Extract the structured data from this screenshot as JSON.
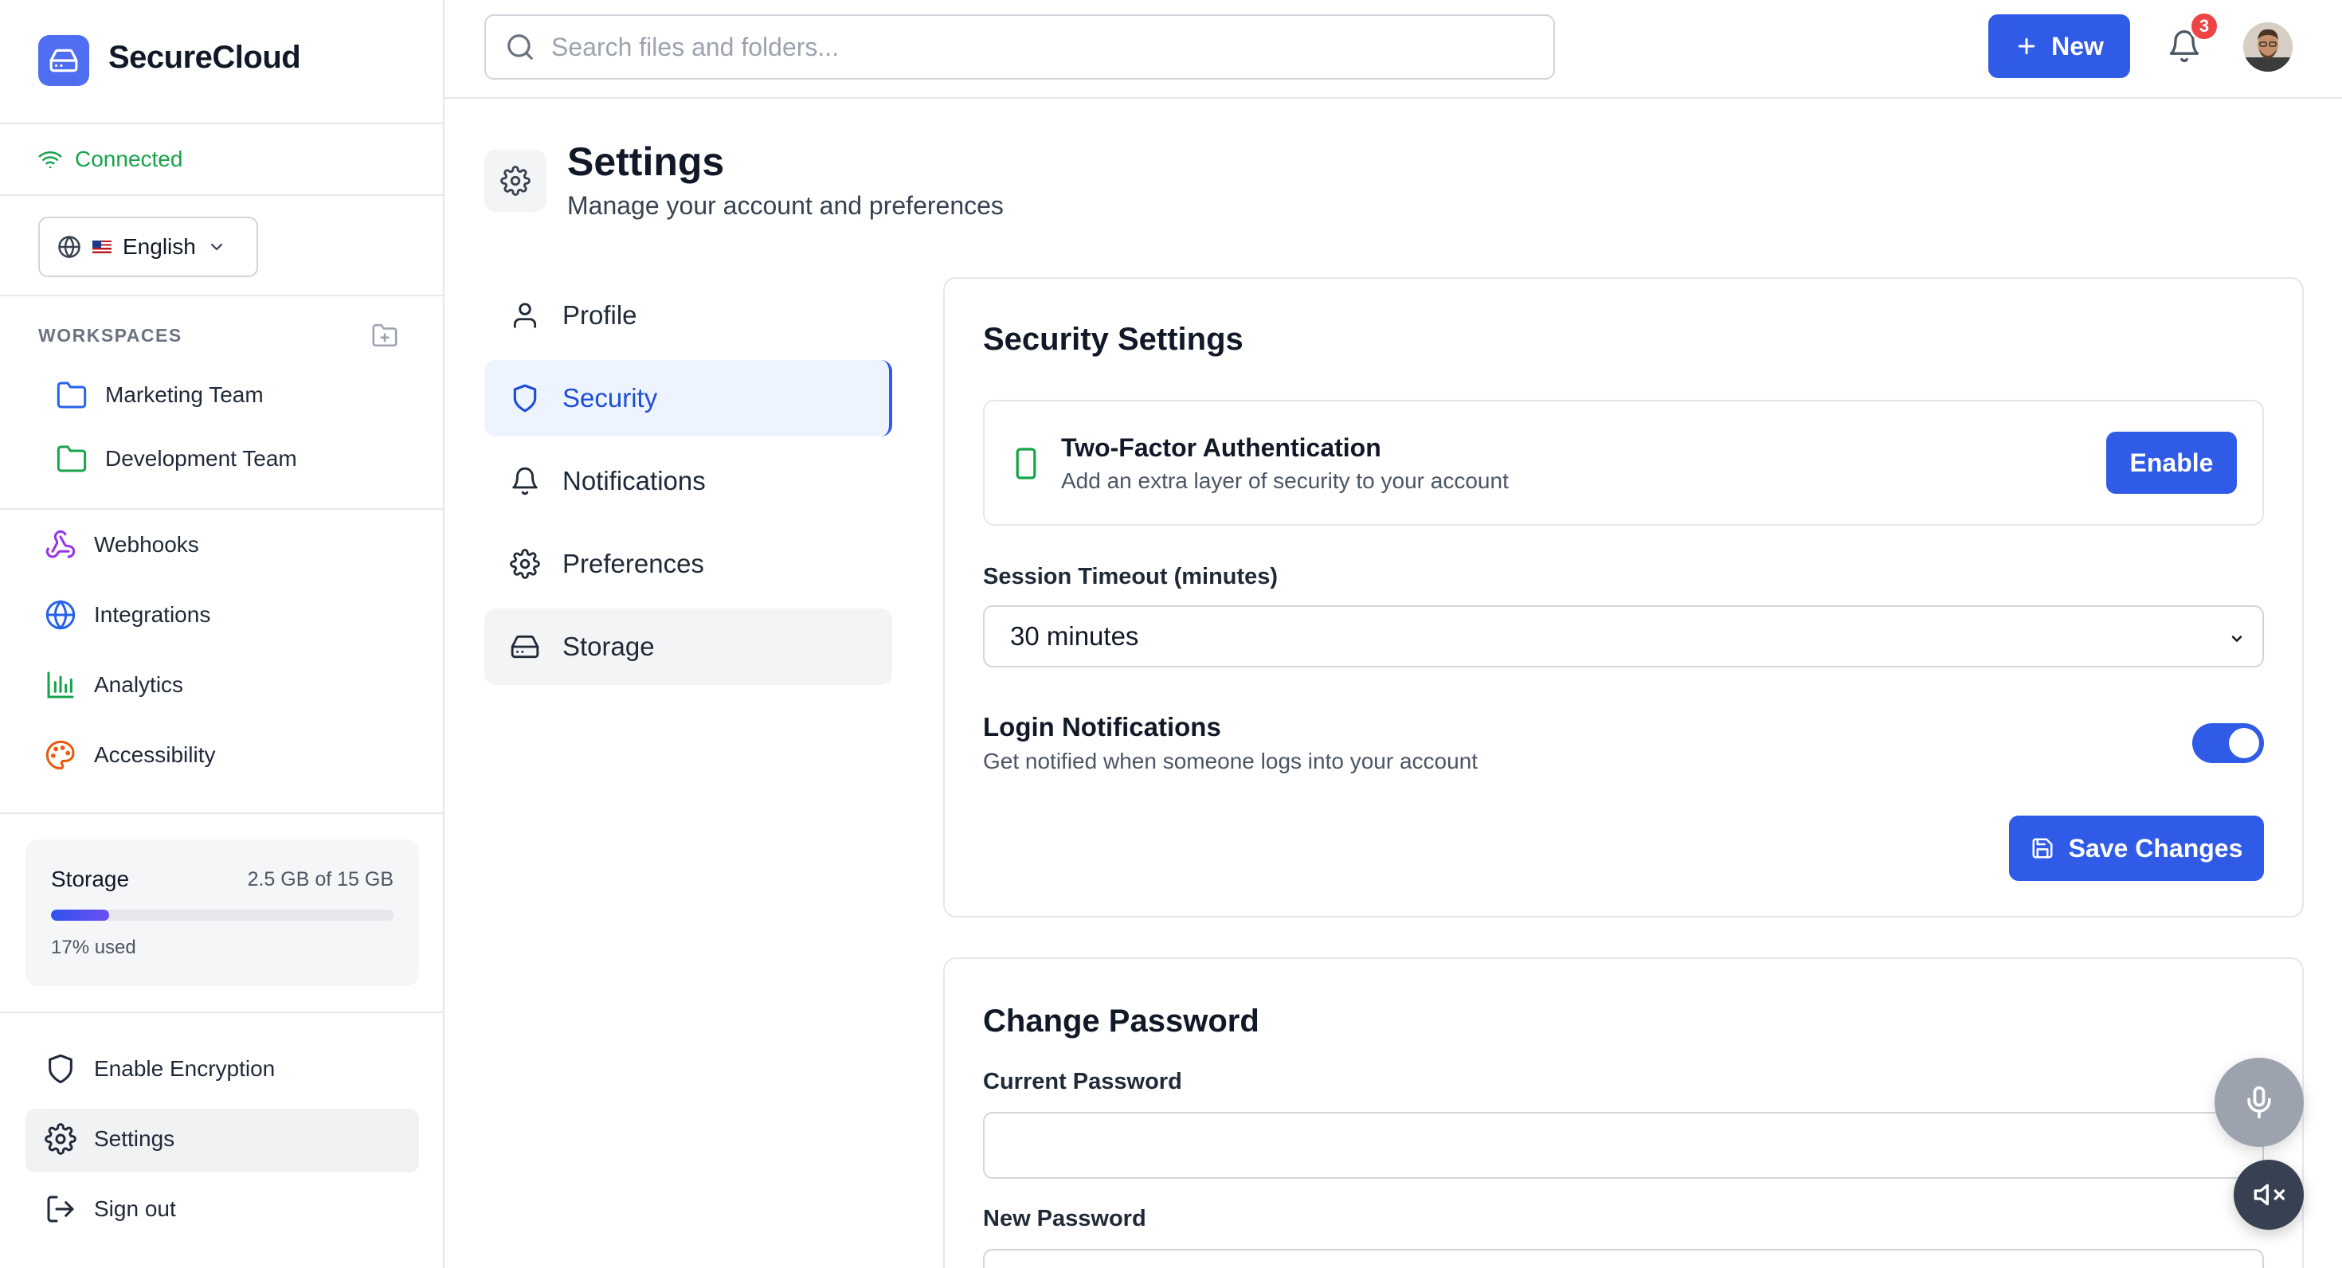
{
  "app": {
    "brand": "SecureCloud",
    "connection_status": "Connected",
    "language": "English"
  },
  "search": {
    "placeholder": "Search files and folders...",
    "value": ""
  },
  "topbar": {
    "new_label": "New",
    "notification_count": "3"
  },
  "sidebar": {
    "workspaces_title": "WORKSPACES",
    "workspaces": [
      {
        "label": "Marketing Team",
        "color": "#2563eb"
      },
      {
        "label": "Development Team",
        "color": "#16a34a"
      }
    ],
    "tools": [
      {
        "label": "Webhooks",
        "icon": "webhook-icon",
        "color": "#9333ea"
      },
      {
        "label": "Integrations",
        "icon": "globe-icon",
        "color": "#2563eb"
      },
      {
        "label": "Analytics",
        "icon": "bar-chart-icon",
        "color": "#16a34a"
      },
      {
        "label": "Accessibility",
        "icon": "palette-icon",
        "color": "#ea580c"
      }
    ],
    "storage": {
      "label": "Storage",
      "value": "2.5 GB of 15 GB",
      "used_text": "17% used",
      "used_fraction": 0.17
    },
    "bottom": [
      {
        "label": "Enable Encryption",
        "icon": "shield-icon"
      },
      {
        "label": "Settings",
        "icon": "gear-icon"
      },
      {
        "label": "Sign out",
        "icon": "sign-out-icon"
      }
    ]
  },
  "page": {
    "title": "Settings",
    "subtitle": "Manage your account and preferences"
  },
  "settings_nav": [
    {
      "label": "Profile",
      "icon": "user-icon"
    },
    {
      "label": "Security",
      "icon": "shield-icon"
    },
    {
      "label": "Notifications",
      "icon": "bell-icon"
    },
    {
      "label": "Preferences",
      "icon": "gear-icon"
    },
    {
      "label": "Storage",
      "icon": "hard-drive-icon"
    }
  ],
  "security": {
    "title": "Security Settings",
    "two_factor": {
      "title": "Two-Factor Authentication",
      "description": "Add an extra layer of security to your account",
      "button": "Enable"
    },
    "session_timeout": {
      "label": "Session Timeout (minutes)",
      "value": "30 minutes"
    },
    "login_notifications": {
      "title": "Login Notifications",
      "description": "Get notified when someone logs into your account",
      "enabled": true
    },
    "save_label": "Save Changes"
  },
  "password": {
    "title": "Change Password",
    "current_label": "Current Password",
    "new_label": "New Password"
  },
  "colors": {
    "accent": "#2f5be7",
    "connected": "#16a34a",
    "badge": "#ef4444"
  }
}
